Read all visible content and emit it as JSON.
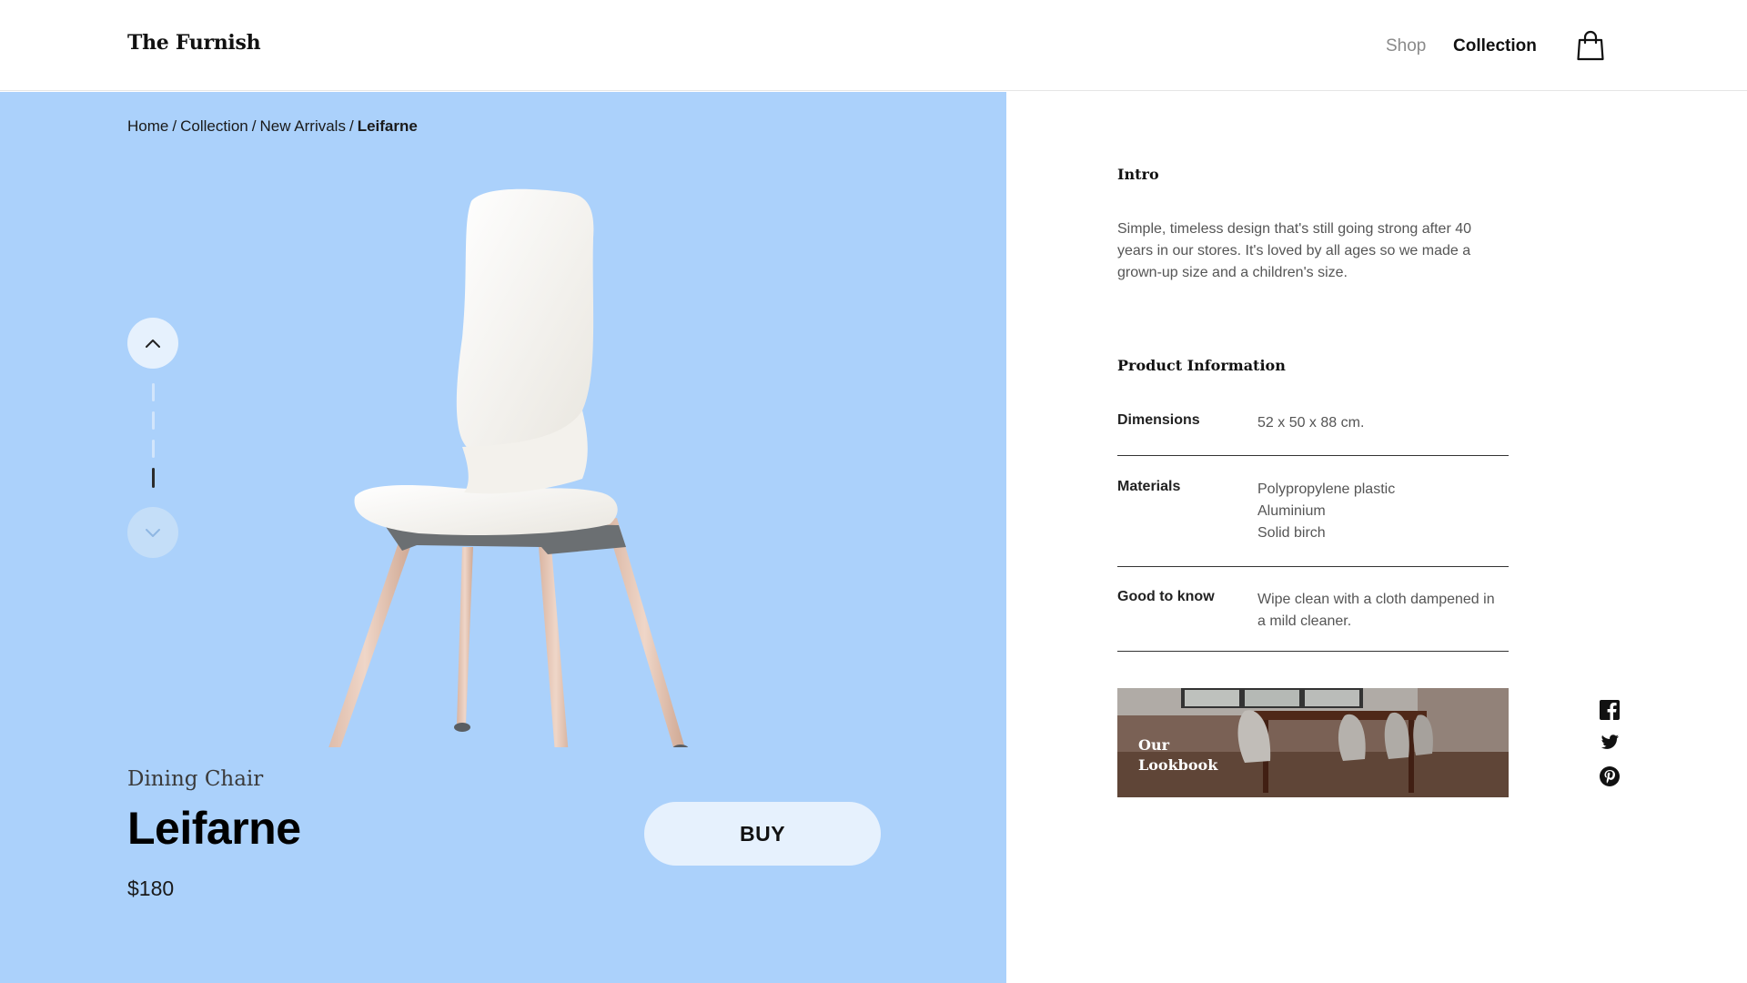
{
  "brand": {
    "name": "The Furnish"
  },
  "nav": {
    "shop": "Shop",
    "collection": "Collection",
    "cart_icon": "shopping-bag-icon"
  },
  "breadcrumb": {
    "items": [
      "Home",
      "Collection",
      "New Arrivals"
    ],
    "current": "Leifarne",
    "separator": "/"
  },
  "gallery": {
    "up_icon": "chevron-up-icon",
    "down_icon": "chevron-down-icon",
    "slide_count": 4,
    "active_slide": 4
  },
  "product": {
    "category": "Dining Chair",
    "name": "Leifarne",
    "price": "$180",
    "buy_label": "BUY"
  },
  "intro": {
    "title": "Intro",
    "text": "Simple, timeless design that's still going strong after 40 years in our stores. It's loved by all ages so we made a grown-up size and a children's size."
  },
  "product_information": {
    "title": "Product Information",
    "specs": [
      {
        "label": "Dimensions",
        "lines": [
          "52 x 50 x 88 cm."
        ]
      },
      {
        "label": "Materials",
        "lines": [
          "Polypropylene plastic",
          "Aluminium",
          "Solid birch"
        ]
      },
      {
        "label": "Good to know",
        "lines": [
          "Wipe clean with a cloth dampened in",
          "a mild cleaner."
        ]
      }
    ]
  },
  "lookbook": {
    "line1": "Our",
    "line2": "Lookbook"
  },
  "social": [
    "facebook-icon",
    "twitter-icon",
    "pinterest-icon"
  ],
  "colors": {
    "hero_background": "#abd1fb",
    "button_background": "#e6f1fd",
    "text_primary": "#111111",
    "text_secondary": "#555555",
    "divider": "#333333"
  }
}
